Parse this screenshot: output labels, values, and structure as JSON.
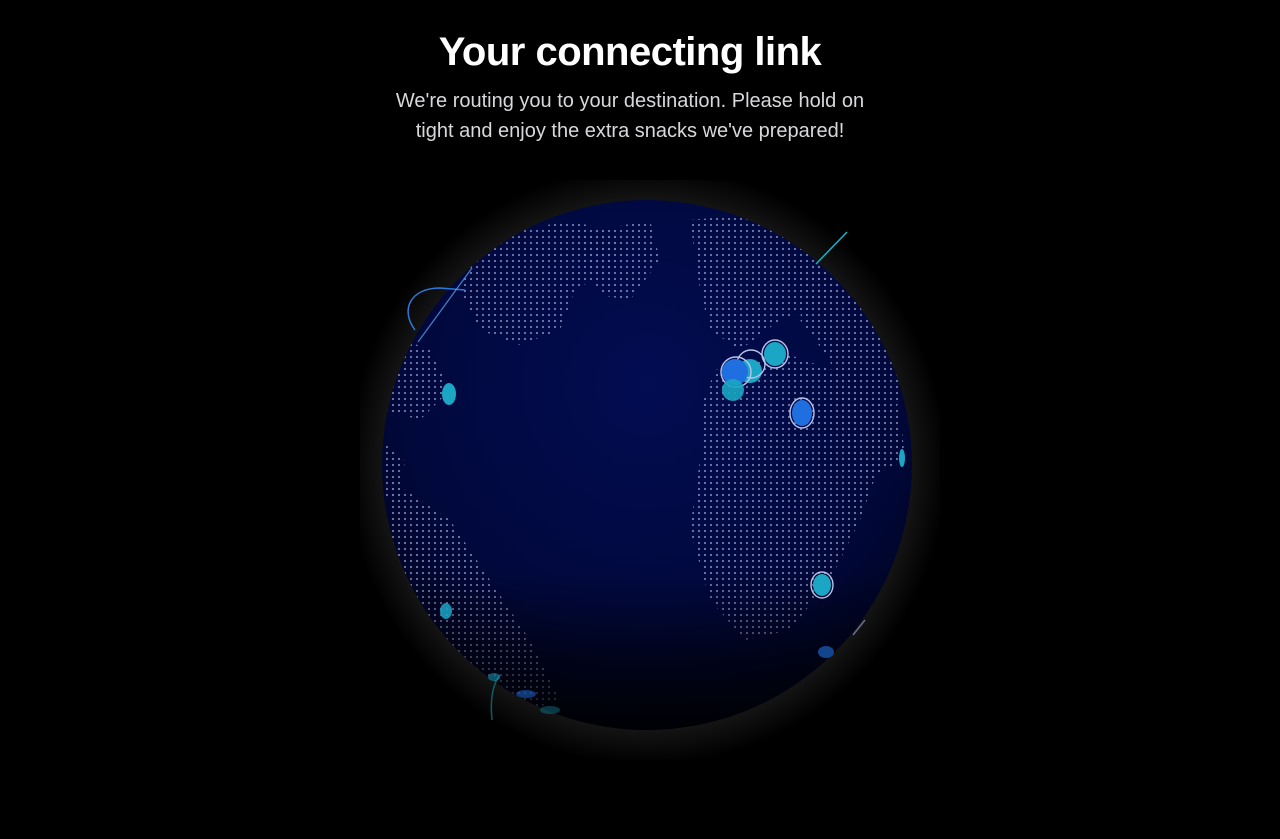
{
  "page": {
    "title": "Your connecting link",
    "subtitle": "We're routing you to your destination. Please hold on tight and enjoy the extra snacks we've prepared!"
  },
  "globe": {
    "icon": "globe-icon",
    "colors": {
      "ocean": "#020a4a",
      "land_dots": "#8f96c8",
      "marker_blue": "#1f6fe0",
      "marker_cyan": "#1aa6c4",
      "glow": "#ffffff"
    }
  }
}
